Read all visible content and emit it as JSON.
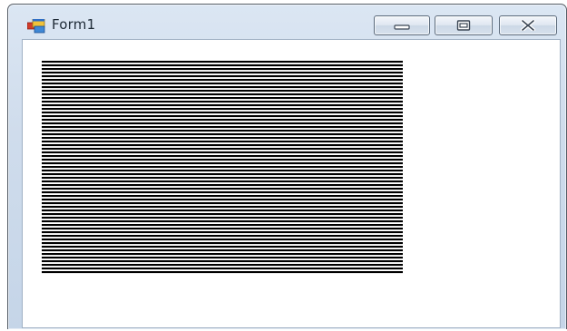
{
  "window": {
    "title": "Form1",
    "icons": {
      "app": "form-app-icon",
      "minimize": "minimize-icon",
      "maximize": "maximize-icon",
      "close": "close-icon"
    }
  },
  "drawing": {
    "description_free": true,
    "line_count": 59,
    "line_color": "#000000"
  }
}
